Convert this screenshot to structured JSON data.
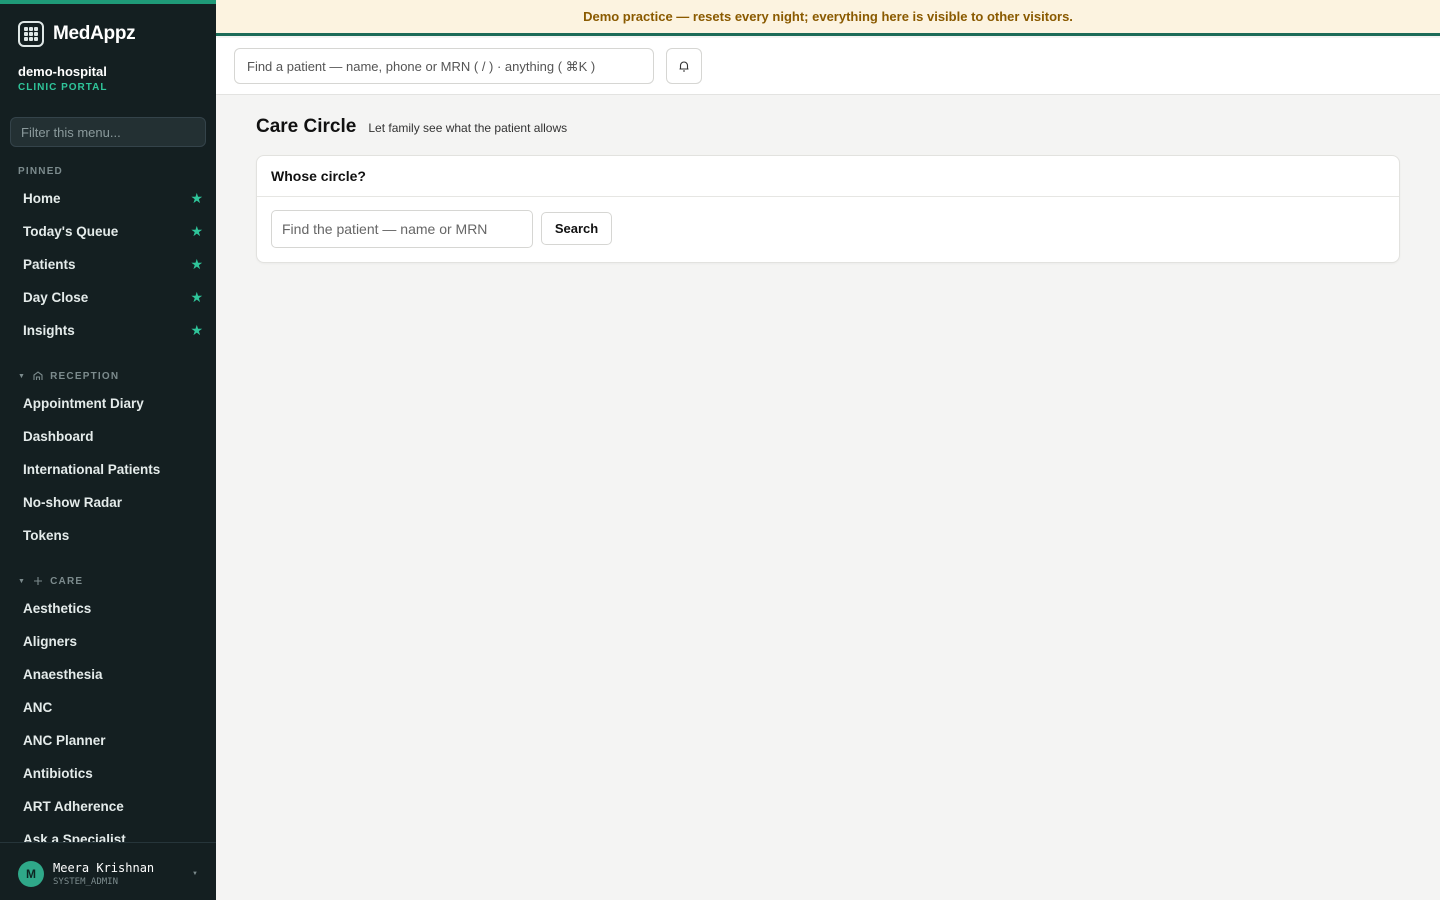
{
  "brand": {
    "name": "MedAppz"
  },
  "org": {
    "name": "demo-hospital",
    "portal": "CLINIC PORTAL"
  },
  "sidebar": {
    "filter_placeholder": "Filter this menu...",
    "pinned_label": "PINNED",
    "pinned": [
      {
        "label": "Home"
      },
      {
        "label": "Today's Queue"
      },
      {
        "label": "Patients"
      },
      {
        "label": "Day Close"
      },
      {
        "label": "Insights"
      }
    ],
    "reception_label": "RECEPTION",
    "reception": [
      {
        "label": "Appointment Diary"
      },
      {
        "label": "Dashboard"
      },
      {
        "label": "International Patients"
      },
      {
        "label": "No-show Radar"
      },
      {
        "label": "Tokens"
      }
    ],
    "care_label": "CARE",
    "care": [
      {
        "label": "Aesthetics"
      },
      {
        "label": "Aligners"
      },
      {
        "label": "Anaesthesia"
      },
      {
        "label": "ANC"
      },
      {
        "label": "ANC Planner"
      },
      {
        "label": "Antibiotics"
      },
      {
        "label": "ART Adherence"
      },
      {
        "label": "Ask a Specialist"
      }
    ]
  },
  "user": {
    "initial": "M",
    "name": "Meera Krishnan",
    "role": "SYSTEM_ADMIN"
  },
  "banner": {
    "text": "Demo practice — resets every night; everything here is visible to other visitors."
  },
  "topbar": {
    "search_placeholder": "Find a patient — name, phone or MRN ( / ) · anything ( ⌘K )"
  },
  "page": {
    "title": "Care Circle",
    "subtitle": "Let family see what the patient allows"
  },
  "card": {
    "title": "Whose circle?",
    "input_placeholder": "Find the patient — name or MRN",
    "button_label": "Search"
  },
  "colors": {
    "accent": "#2fc59a",
    "sidebar_bg": "#141f21",
    "banner_bg": "#fcf3e0",
    "banner_text": "#8a5a00"
  }
}
